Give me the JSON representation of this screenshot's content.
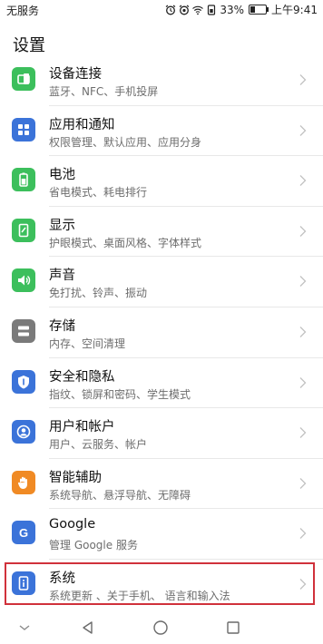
{
  "status": {
    "carrier": "无服务",
    "battery": "33%",
    "time": "上午9:41",
    "battery_level": 0.33
  },
  "header": {
    "title": "设置"
  },
  "items": [
    {
      "name": "device-connection",
      "label": "设备连接",
      "sub": "蓝牙、NFC、手机投屏",
      "icon": "device-connection-icon",
      "color": "#3cbf5c"
    },
    {
      "name": "apps-notifications",
      "label": "应用和通知",
      "sub": "权限管理、默认应用、应用分身",
      "icon": "apps-grid-icon",
      "color": "#3b73d9"
    },
    {
      "name": "battery",
      "label": "电池",
      "sub": "省电模式、耗电排行",
      "icon": "battery-icon",
      "color": "#3cbf5c"
    },
    {
      "name": "display",
      "label": "显示",
      "sub": "护眼模式、桌面风格、字体样式",
      "icon": "display-icon",
      "color": "#3cbf5c"
    },
    {
      "name": "sound",
      "label": "声音",
      "sub": "免打扰、铃声、振动",
      "icon": "speaker-icon",
      "color": "#3cbf5c"
    },
    {
      "name": "storage",
      "label": "存储",
      "sub": "内存、空间清理",
      "icon": "storage-icon",
      "color": "#7a7a7a"
    },
    {
      "name": "security-privacy",
      "label": "安全和隐私",
      "sub": "指纹、锁屏和密码、学生模式",
      "icon": "shield-icon",
      "color": "#3b73d9"
    },
    {
      "name": "users-accounts",
      "label": "用户和帐户",
      "sub": "用户、云服务、帐户",
      "icon": "user-icon",
      "color": "#3b73d9"
    },
    {
      "name": "accessibility",
      "label": "智能辅助",
      "sub": "系统导航、悬浮导航、无障碍",
      "icon": "hand-icon",
      "color": "#f08a24"
    },
    {
      "name": "google",
      "label": "Google",
      "sub": "管理 Google 服务",
      "icon": "google-icon",
      "color": "#3b73d9"
    },
    {
      "name": "system",
      "label": "系统",
      "sub": "系统更新 、关于手机、 语言和输入法",
      "icon": "info-phone-icon",
      "color": "#3b73d9"
    }
  ],
  "highlight_color": "#d0313b"
}
